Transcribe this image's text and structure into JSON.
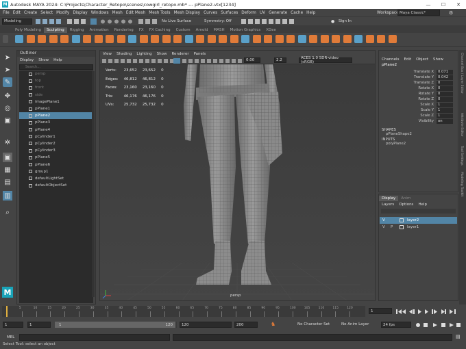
{
  "titlebar": {
    "logo": "M",
    "title": "Autodesk MAYA 2024: C:\\Projects\\Character_Retopo\\scenes\\cowgirl_retopo.mb*    ---    pPlane2.vtx[1234]",
    "min": "—",
    "max": "☐",
    "close": "✕"
  },
  "menubar": [
    "File",
    "Edit",
    "Create",
    "Select",
    "Modify",
    "Display",
    "Windows",
    "Mesh",
    "Edit Mesh",
    "Mesh Tools",
    "Mesh Display",
    "Curves",
    "Surfaces",
    "Deform",
    "UV",
    "Generate",
    "Cache",
    "Help"
  ],
  "workspace": {
    "label": "Workspace :",
    "value": "Maya Classic*"
  },
  "status": {
    "menuset": "Modeling",
    "live": "No Live Surface",
    "symmetry": "Symmetry: Off",
    "signin": "Sign In"
  },
  "shelf_tabs": [
    "Poly Modeling",
    "Sculpting",
    "Rigging",
    "Animation",
    "Rendering",
    "FX",
    "FX Caching",
    "Custom",
    "Arnold",
    "MASH",
    "Motion Graphics",
    "XGen"
  ],
  "shelf_active": 1,
  "outliner": {
    "title": "Outliner",
    "menu": [
      "Display",
      "Show",
      "Help"
    ],
    "search_placeholder": "Search...",
    "items": [
      {
        "label": "persp",
        "dim": true,
        "sel": false,
        "icon": "camera-icon"
      },
      {
        "label": "top",
        "dim": true,
        "sel": false,
        "icon": "camera-icon"
      },
      {
        "label": "front",
        "dim": true,
        "sel": false,
        "icon": "camera-icon"
      },
      {
        "label": "side",
        "dim": true,
        "sel": false,
        "icon": "camera-icon"
      },
      {
        "label": "imagePlane1",
        "dim": false,
        "sel": false,
        "icon": "image-plane-icon"
      },
      {
        "label": "pPlane1",
        "dim": false,
        "sel": false,
        "icon": "mesh-icon"
      },
      {
        "label": "pPlane2",
        "dim": false,
        "sel": true,
        "icon": "mesh-icon"
      },
      {
        "label": "pPlane3",
        "dim": false,
        "sel": false,
        "icon": "mesh-icon"
      },
      {
        "label": "pPlane4",
        "dim": false,
        "sel": false,
        "icon": "mesh-icon"
      },
      {
        "label": "pCylinder1",
        "dim": false,
        "sel": false,
        "icon": "mesh-icon"
      },
      {
        "label": "pCylinder2",
        "dim": false,
        "sel": false,
        "icon": "mesh-icon"
      },
      {
        "label": "pCylinder3",
        "dim": false,
        "sel": false,
        "icon": "mesh-icon"
      },
      {
        "label": "pPlane5",
        "dim": false,
        "sel": false,
        "icon": "mesh-icon"
      },
      {
        "label": "pPlane6",
        "dim": false,
        "sel": false,
        "icon": "mesh-icon"
      },
      {
        "label": "group1",
        "dim": false,
        "sel": false,
        "icon": "group-icon"
      },
      {
        "label": "defaultLightSet",
        "dim": false,
        "sel": false,
        "icon": "set-icon"
      },
      {
        "label": "defaultObjectSet",
        "dim": false,
        "sel": false,
        "icon": "set-icon"
      }
    ]
  },
  "viewport": {
    "menu": [
      "View",
      "Shading",
      "Lighting",
      "Show",
      "Renderer",
      "Panels"
    ],
    "exposure": "0.00",
    "gamma": "2.2",
    "colorspace": "ACES 1.0 SDR-video (sRGB)",
    "hud": [
      {
        "label": "Verts:",
        "a": "23,652",
        "b": "23,652",
        "c": "0"
      },
      {
        "label": "Edges:",
        "a": "46,812",
        "b": "46,812",
        "c": "0"
      },
      {
        "label": "Faces:",
        "a": "23,160",
        "b": "23,160",
        "c": "0"
      },
      {
        "label": "Tris:",
        "a": "46,176",
        "b": "46,176",
        "c": "0"
      },
      {
        "label": "UVs:",
        "a": "25,732",
        "b": "25,732",
        "c": "0"
      }
    ],
    "camera": "persp"
  },
  "channel_box": {
    "menu": [
      "Channels",
      "Edit",
      "Object",
      "Show"
    ],
    "object": "pPlane2",
    "attrs": [
      {
        "label": "Translate X",
        "value": "0.071"
      },
      {
        "label": "Translate Y",
        "value": "0.042"
      },
      {
        "label": "Translate Z",
        "value": "0"
      },
      {
        "label": "Rotate X",
        "value": "0"
      },
      {
        "label": "Rotate Y",
        "value": "0"
      },
      {
        "label": "Rotate Z",
        "value": "0"
      },
      {
        "label": "Scale X",
        "value": "1"
      },
      {
        "label": "Scale Y",
        "value": "1"
      },
      {
        "label": "Scale Z",
        "value": "1"
      },
      {
        "label": "Visibility",
        "value": "on"
      }
    ],
    "shapes_head": "SHAPES",
    "shape": "pPlaneShape2",
    "inputs_head": "INPUTS",
    "input": "polyPlane2"
  },
  "side_tabs": [
    "Channel Box / Layer Editor",
    "Attribute Editor",
    "Tool Settings",
    "Modeling Toolkit"
  ],
  "layers": {
    "tabs": [
      "Display",
      "Anim"
    ],
    "menu": [
      "Layers",
      "Options",
      "Help"
    ],
    "rows": [
      {
        "v": "V",
        "p": "",
        "name": "layer2",
        "sel": true
      },
      {
        "v": "V",
        "p": "P",
        "name": "layer1",
        "sel": false
      }
    ]
  },
  "timeline": {
    "ticks": [
      "5",
      "10",
      "15",
      "20",
      "25",
      "30",
      "35",
      "40",
      "45",
      "50",
      "55",
      "60",
      "65",
      "70",
      "75",
      "80",
      "85",
      "90",
      "95",
      "100",
      "105",
      "110",
      "115",
      "120"
    ],
    "current": "1"
  },
  "range": {
    "start": "1",
    "start2": "1",
    "rstart": "1",
    "rend": "120",
    "end": "120",
    "end2": "200",
    "char": "No Character Set",
    "anim": "No Anim Layer",
    "fps": "24 fps"
  },
  "mel": {
    "label": "MEL"
  },
  "help": "Select Tool: select an object",
  "colors": {
    "selection": "#5285a6",
    "accent": "#e07b39"
  }
}
